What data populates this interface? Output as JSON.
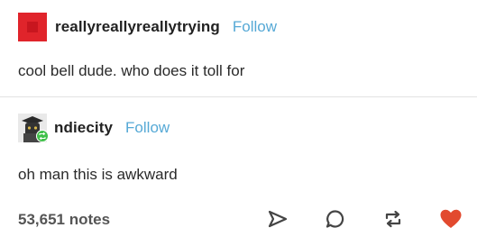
{
  "posts": [
    {
      "username": "reallyreallyreallytrying",
      "follow_label": "Follow",
      "text": "cool bell dude. who does it toll for",
      "avatar_color": "#e0242b"
    },
    {
      "username": "ndiecity",
      "follow_label": "Follow",
      "text": "oh man this is awkward",
      "avatar_icon": "reblog-badge-icon"
    }
  ],
  "footer": {
    "notes": "53,651 notes",
    "actions": [
      "share-icon",
      "reply-icon",
      "reblog-icon",
      "like-heart-icon"
    ],
    "like_color": "#e24a2f"
  }
}
